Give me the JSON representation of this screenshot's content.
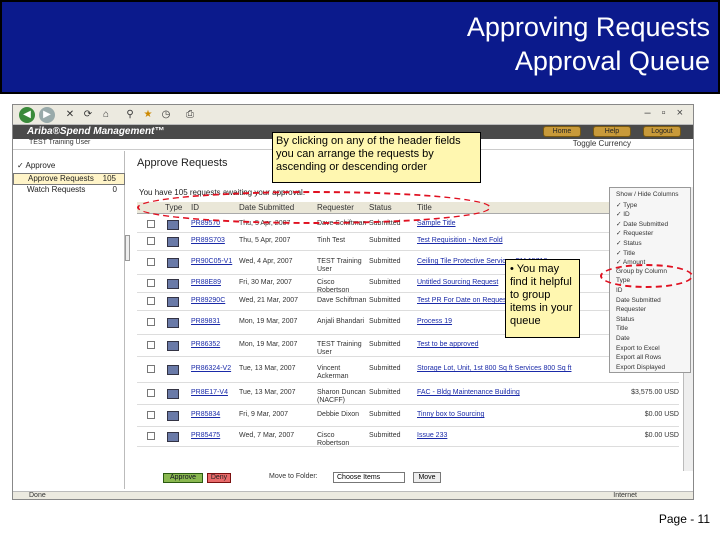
{
  "slide": {
    "title_line1": "Approving Requests",
    "title_line2": "Approval Queue",
    "page_number": "Page - 11",
    "banner_color": "#0b1a8c"
  },
  "browser": {
    "status_left": "Done",
    "status_right": "Internet",
    "window_controls": "– ▫ ×"
  },
  "app": {
    "logo": "Ariba®Spend Management™",
    "top_buttons": [
      "Home",
      "Help",
      "Logout"
    ],
    "user": "TEST Training User",
    "currency": "Toggle Currency"
  },
  "sidebar": {
    "heading": "✓ Approve",
    "items": [
      {
        "label": "Approve Requests",
        "count": "105"
      },
      {
        "label": "Watch Requests",
        "count": "0"
      }
    ]
  },
  "main": {
    "title": "Approve Requests",
    "summary": "You have 105 requests awaiting your approval.",
    "columns": [
      "Type",
      "ID",
      "Date Submitted",
      "Requester",
      "Status",
      "Title"
    ],
    "rows": [
      {
        "id": "PR89570",
        "date": "Thu, 5 Apr, 2007",
        "requester": "Dave Schiftman",
        "status": "Submitted",
        "title": "Sample Title",
        "amount": "$7"
      },
      {
        "id": "PR89S703",
        "date": "Thu, 5 Apr, 2007",
        "requester": "Tinh Test",
        "status": "Submitted",
        "title": "Test Requisition - Next Fold",
        "amount": ""
      },
      {
        "id": "PR90C05-V1",
        "date": "Wed, 4 Apr, 2007",
        "requester": "TEST Training User",
        "status": "Submitted",
        "title": "Ceiling Tile Protective Services CM 15710",
        "amount": "$3"
      },
      {
        "id": "PR88E89",
        "date": "Fri, 30 Mar, 2007",
        "requester": "Cisco Robertson",
        "status": "Submitted",
        "title": "Untitled Sourcing Request",
        "amount": ""
      },
      {
        "id": "PR89290C",
        "date": "Wed, 21 Mar, 2007",
        "requester": "Dave Schiftman",
        "status": "Submitted",
        "title": "Test PR For Date on Request",
        "amount": "$"
      },
      {
        "id": "PR89831",
        "date": "Mon, 19 Mar, 2007",
        "requester": "Anjali Bhandari",
        "status": "Submitted",
        "title": "Process 19",
        "amount": ""
      },
      {
        "id": "PR86352",
        "date": "Mon, 19 Mar, 2007",
        "requester": "TEST Training User",
        "status": "Submitted",
        "title": "Test to be approved",
        "amount": "$0.00 USD"
      },
      {
        "id": "PR86324-V2",
        "date": "Tue, 13 Mar, 2007",
        "requester": "Vincent Ackerman",
        "status": "Submitted",
        "title": "Storage Lot, Unit, 1st 800 Sq ft Services 800 Sq ft",
        "amount": "$0.00 USD"
      },
      {
        "id": "PR8E17-V4",
        "date": "Tue, 13 Mar, 2007",
        "requester": "Sharon Duncan (NACFF)",
        "status": "Submitted",
        "title": "FAC - Bldg Maintenance Building",
        "amount": "$3,575.00 USD"
      },
      {
        "id": "PR85834",
        "date": "Fri, 9 Mar, 2007",
        "requester": "Debbie Dixon",
        "status": "Submitted",
        "title": "Tinny box to Sourcing",
        "amount": "$0.00 USD"
      },
      {
        "id": "PR85475",
        "date": "Wed, 7 Mar, 2007",
        "requester": "Cisco Robertson",
        "status": "Submitted",
        "title": "Issue 233",
        "amount": "$0.00 USD"
      }
    ]
  },
  "column_menu": {
    "items": [
      "Show / Hide Columns",
      "✓ Type",
      "✓ ID",
      "✓ Date Submitted",
      "✓ Requester",
      "✓ Status",
      "✓ Title",
      "✓ Amount",
      "Group by Column",
      "Type",
      "ID",
      "Date Submitted",
      "Requester",
      "Status",
      "Title",
      "Date",
      "Export to Excel",
      "Export all Rows",
      "Export Displayed"
    ]
  },
  "footer": {
    "approve": "Approve",
    "deny": "Deny",
    "move_label": "Move to Folder:",
    "folder_select": "Choose Items",
    "move_button": "Move"
  },
  "callouts": {
    "header_tip": "By clicking on any of the header fields you can arrange the requests by ascending or descending order",
    "group_tip": "• You may find it helpful to group items in your queue"
  }
}
